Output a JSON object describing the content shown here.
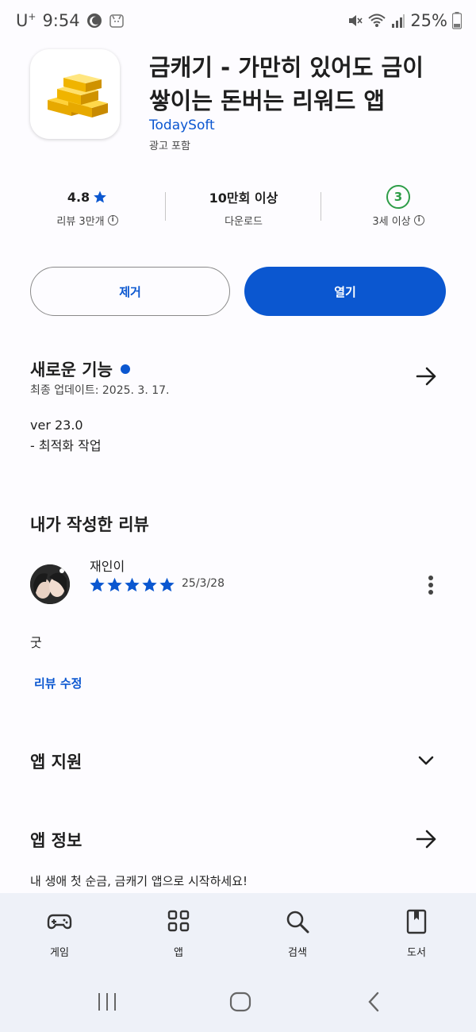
{
  "status_bar": {
    "carrier": "U",
    "carrier_sup": "+",
    "time": "9:54",
    "battery": "25%"
  },
  "app": {
    "title": "금캐기 - 가만히 있어도 금이 쌓이는 돈버는 리워드 앱",
    "developer": "TodaySoft",
    "ads_note": "광고 포함",
    "icon": "gold-bars-icon"
  },
  "stats": {
    "rating": "4.8",
    "rating_label": "리뷰 3만개",
    "downloads": "10만회 이상",
    "downloads_label": "다운로드",
    "age_badge": "3",
    "age_label": "3세 이상"
  },
  "buttons": {
    "remove": "제거",
    "open": "열기"
  },
  "whats_new": {
    "title": "새로운 기능",
    "updated": "최종 업데이트: 2025. 3. 17.",
    "version": "ver 23.0",
    "note": "- 최적화 작업"
  },
  "my_review": {
    "title": "내가 작성한 리뷰",
    "reviewer": "재인이",
    "stars": 5,
    "date": "25/3/28",
    "text": "굿",
    "edit_label": "리뷰 수정"
  },
  "app_support": {
    "title": "앱 지원"
  },
  "app_info": {
    "title": "앱 정보",
    "description": "내 생애 첫 순금, 금캐기 앱으로 시작하세요!"
  },
  "bottom_nav": {
    "items": [
      {
        "label": "게임",
        "icon": "gamepad-icon"
      },
      {
        "label": "앱",
        "icon": "apps-grid-icon"
      },
      {
        "label": "검색",
        "icon": "search-icon"
      },
      {
        "label": "도서",
        "icon": "book-icon"
      }
    ]
  },
  "colors": {
    "accent": "#0b57d0",
    "age_green": "#2e9d48",
    "nav_bg": "#eef1f8"
  }
}
